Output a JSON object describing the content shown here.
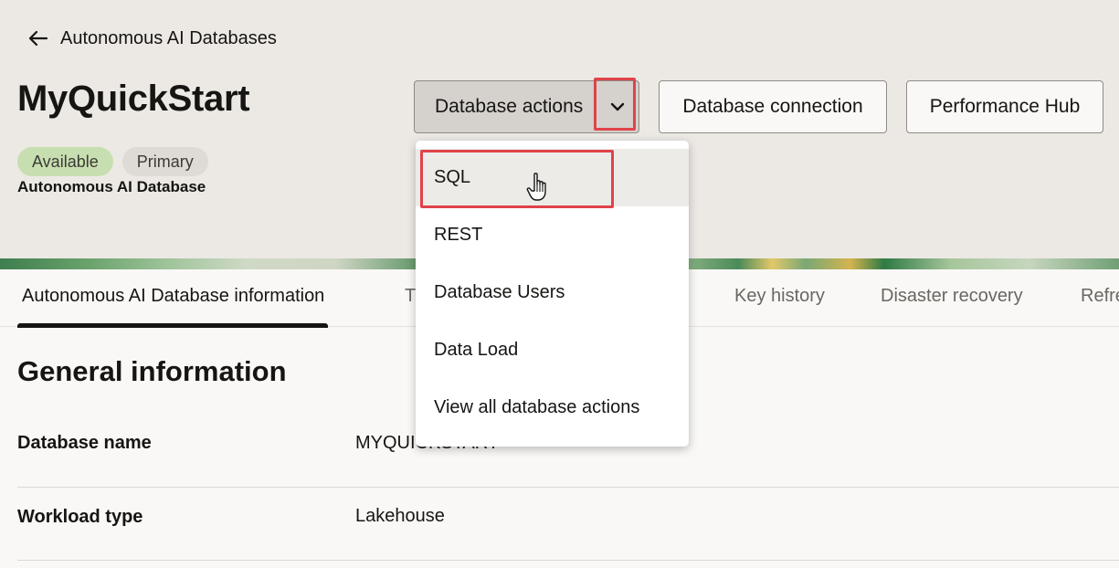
{
  "header": {
    "back_label": "Autonomous AI Databases",
    "title": "MyQuickStart",
    "badges": {
      "status": "Available",
      "role": "Primary"
    },
    "subtype": "Autonomous AI Database"
  },
  "actions": {
    "database_actions": "Database actions",
    "database_connection": "Database connection",
    "performance_hub": "Performance Hub"
  },
  "menu": {
    "items": [
      {
        "label": "SQL"
      },
      {
        "label": "REST"
      },
      {
        "label": "Database Users"
      },
      {
        "label": "Data Load"
      },
      {
        "label": "View all database actions"
      }
    ]
  },
  "tabs": [
    {
      "label": "Autonomous AI Database information"
    },
    {
      "label": "T"
    },
    {
      "label": "Key history"
    },
    {
      "label": "Disaster recovery"
    },
    {
      "label": "Refre"
    }
  ],
  "general": {
    "title": "General information",
    "rows": [
      {
        "label": "Database name",
        "value": "MYQUICKSTART"
      },
      {
        "label": "Workload type",
        "value": "Lakehouse"
      }
    ]
  },
  "colors": {
    "highlight": "#e0434a",
    "available_badge": "#c7dfb0",
    "primary_badge": "#dedad5"
  }
}
